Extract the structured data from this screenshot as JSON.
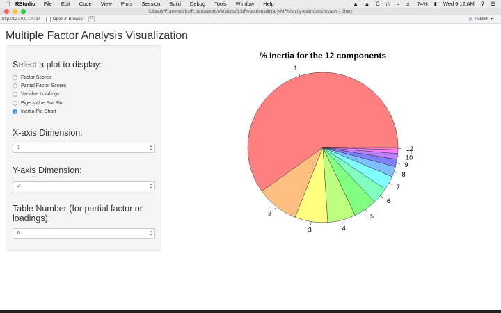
{
  "mac_menu": {
    "app": "RStudio",
    "items": [
      "File",
      "Edit",
      "Code",
      "View",
      "Plots",
      "Session",
      "Build",
      "Debug",
      "Tools",
      "Window",
      "Help"
    ],
    "battery": "74%",
    "clock": "Wed 9:12 AM"
  },
  "window": {
    "title": "/Library/Frameworks/R.framework/Versions/3.3/Resources/library/MFA/shiny-examples/myapp - Shiny"
  },
  "toolbar": {
    "url": "http://127.0.0.1:4714",
    "open_browser": "Open in Browser",
    "publish": "Publish"
  },
  "app": {
    "title": "Multiple Factor Analysis Visualization",
    "plot_select_label": "Select a plot to display:",
    "plot_options": [
      "Factor Scores",
      "Partial Factor Scores",
      "Variable Loadings",
      "Eigenvalue Bar Plot",
      "Inertia Pie Chart"
    ],
    "selected_plot": "Inertia Pie Chart",
    "x_axis_label": "X-axis Dimension:",
    "x_axis_value": "1",
    "y_axis_label": "Y-axis Dimension:",
    "y_axis_value": "2",
    "table_label": "Table Number (for partial factor or loadings):",
    "table_value": "6"
  },
  "chart_data": {
    "type": "pie",
    "title": "% Inertia for the 12 components",
    "categories": [
      "1",
      "2",
      "3",
      "4",
      "5",
      "6",
      "7",
      "8",
      "9",
      "10",
      "11",
      "12"
    ],
    "values": [
      59.5,
      9.0,
      7.0,
      6.0,
      5.0,
      3.5,
      3.0,
      2.2,
      1.6,
      1.2,
      0.8,
      0.5
    ],
    "colors": [
      "#ff8080",
      "#ffbf80",
      "#ffff80",
      "#bfff80",
      "#80ff80",
      "#80ffbf",
      "#80ffff",
      "#80bfff",
      "#8080ff",
      "#bf80ff",
      "#ff80ff",
      "#ff80bf"
    ],
    "start": "3 o'clock",
    "direction": "counter-clockwise"
  }
}
